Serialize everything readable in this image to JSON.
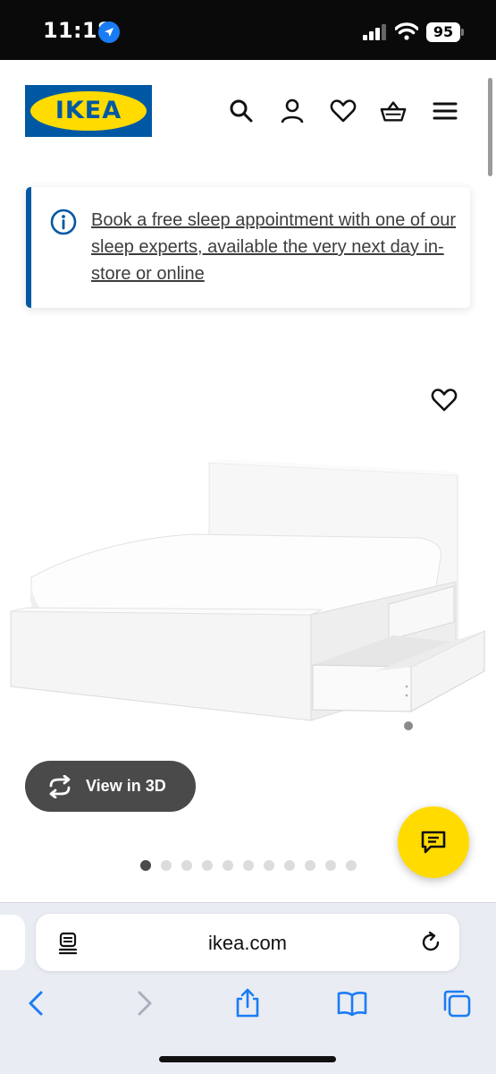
{
  "status_bar": {
    "time": "11:18",
    "battery": "95"
  },
  "header": {
    "logo_text": "IKEA",
    "icons": [
      "search-icon",
      "account-icon",
      "favourites-icon",
      "basket-icon",
      "menu-icon"
    ]
  },
  "notice": {
    "icon": "info-icon",
    "text": "Book a free sleep appointment with one of our sleep experts, available the very next day in-store or online"
  },
  "product": {
    "view3d_label": "View in 3D",
    "carousel_count": 11,
    "carousel_active": 0
  },
  "browser": {
    "url": "ikea.com",
    "toolbar": [
      "back-icon",
      "forward-icon",
      "share-icon",
      "bookmarks-icon",
      "tabs-icon"
    ]
  },
  "colors": {
    "ikea_blue": "#0058a3",
    "ikea_yellow": "#ffdb00",
    "ios_blue": "#1a7cf5"
  }
}
